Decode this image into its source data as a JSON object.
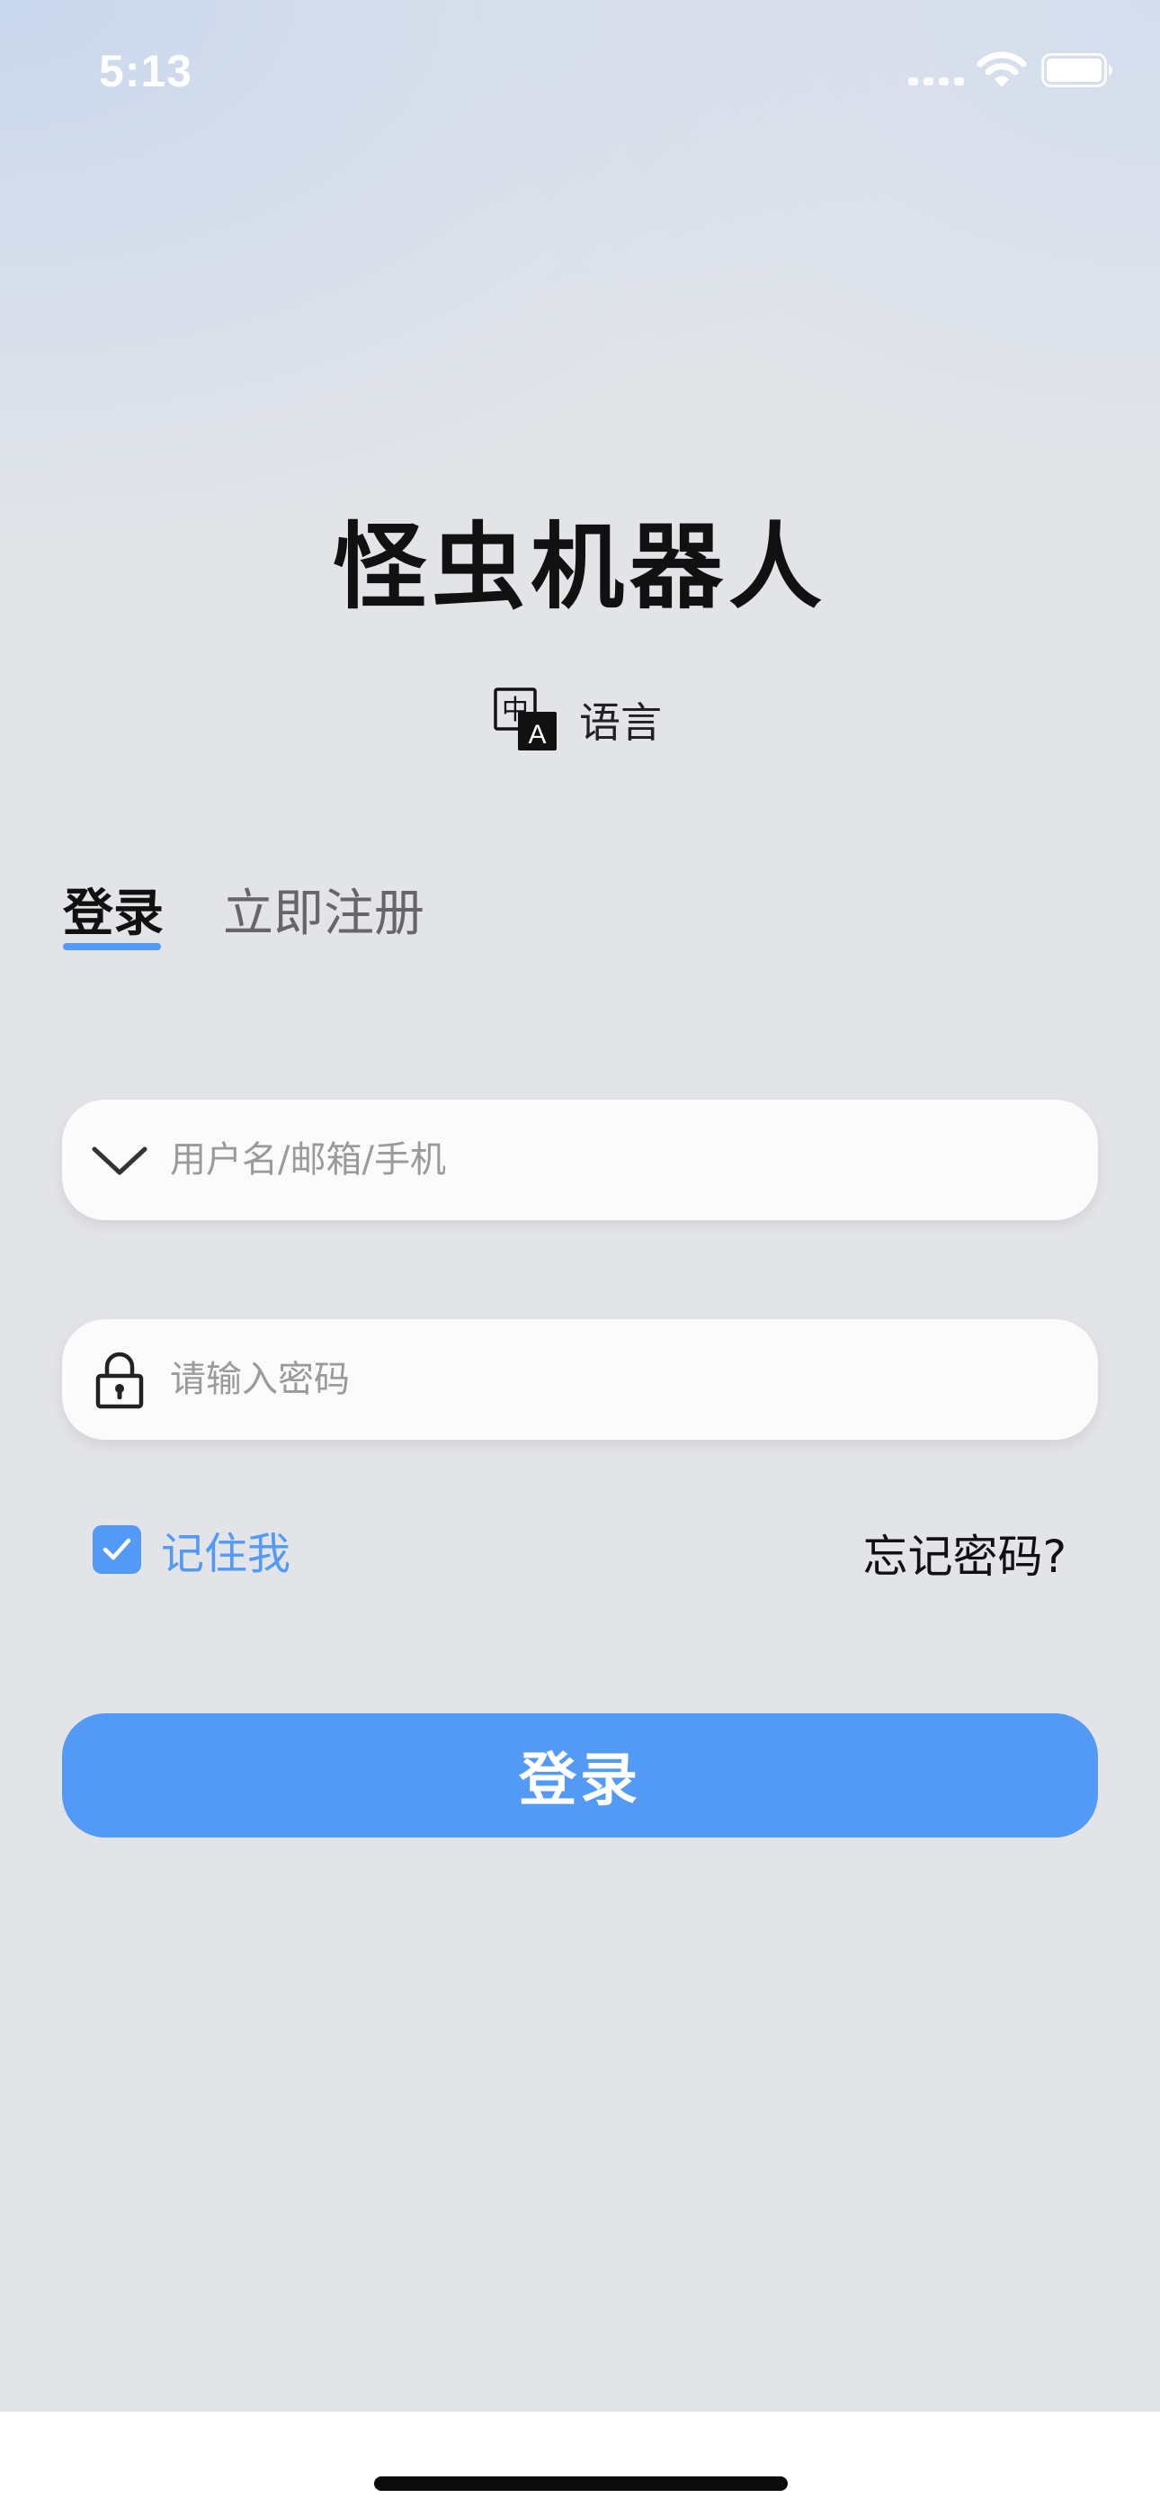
{
  "status_bar": {
    "time": "5:13",
    "icons": [
      "signal-dots-icon",
      "wifi-icon",
      "battery-icon"
    ]
  },
  "app": {
    "title": "怪虫机器人"
  },
  "language": {
    "icon": "translate-icon",
    "icon_glyph_top": "中",
    "icon_glyph_bottom": "A",
    "label": "语言"
  },
  "tabs": [
    {
      "label": "登录",
      "active": true
    },
    {
      "label": "立即注册",
      "active": false
    }
  ],
  "form": {
    "username": {
      "icon": "chevron-down-icon",
      "placeholder": "用户名/邮箱/手机",
      "value": ""
    },
    "password": {
      "icon": "lock-icon",
      "placeholder": "请输入密码",
      "value": ""
    },
    "remember": {
      "label": "记住我",
      "checked": true
    },
    "forgot_label": "忘记密码?",
    "submit_label": "登录"
  },
  "colors": {
    "accent": "#5399f6",
    "background": "#e3e4e8",
    "field_background": "#fbfbfb",
    "title_text": "#111111",
    "inactive_tab": "#666666",
    "placeholder": "#9a9a9a"
  }
}
